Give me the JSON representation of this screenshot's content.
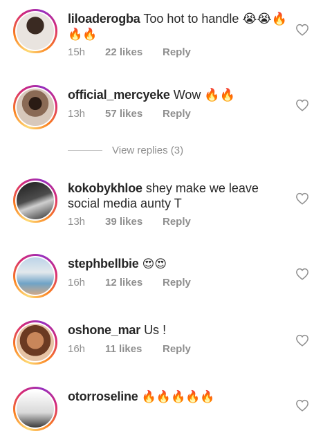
{
  "comments": [
    {
      "username": "liloaderogba",
      "text_line1": "Too hot to handle 😭😭🔥",
      "text_line2": "🔥🔥",
      "time": "15h",
      "likes": "22 likes",
      "reply": "Reply",
      "avatar_icon": "profile-photo"
    },
    {
      "username": "official_mercyeke",
      "text_line1": "Wow 🔥🔥",
      "time": "13h",
      "likes": "57 likes",
      "reply": "Reply",
      "avatar_icon": "profile-photo"
    },
    {
      "username": "kokobykhloe",
      "text_line1": "shey make we leave",
      "text_line2": "social media aunty T",
      "time": "13h",
      "likes": "39 likes",
      "reply": "Reply",
      "avatar_icon": "profile-photo"
    },
    {
      "username": "stephbellbie",
      "text_line1": "😍😍",
      "time": "16h",
      "likes": "12 likes",
      "reply": "Reply",
      "avatar_icon": "profile-photo"
    },
    {
      "username": "oshone_mar",
      "text_line1": "Us !",
      "time": "16h",
      "likes": "11 likes",
      "reply": "Reply",
      "avatar_icon": "profile-photo"
    },
    {
      "username": "otorroseline",
      "text_line1": "🔥🔥🔥🔥🔥",
      "avatar_icon": "profile-photo"
    }
  ],
  "view_replies": "View replies (3)",
  "icons": {
    "like": "heart-outline-icon"
  },
  "colors": {
    "ring_gradient": [
      "#feda75",
      "#fa7e1e",
      "#d62976",
      "#962fbf"
    ],
    "meta": "#8e8e8e",
    "text": "#262626"
  }
}
